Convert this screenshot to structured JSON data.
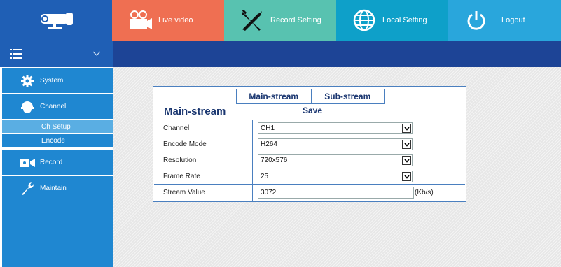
{
  "header": {
    "tabs": [
      {
        "label": "Live video",
        "icon": "camera-icon"
      },
      {
        "label": "Record Setting",
        "icon": "tools-icon"
      },
      {
        "label": "Local Setting",
        "icon": "globe-icon"
      },
      {
        "label": "Logout",
        "icon": "power-icon"
      }
    ]
  },
  "sidebar": {
    "items": [
      {
        "label": "System",
        "icon": "gear-icon"
      },
      {
        "label": "Channel",
        "icon": "dome-camera-icon"
      },
      {
        "label": "Record",
        "icon": "video-camera-icon"
      },
      {
        "label": "Maintain",
        "icon": "wrench-icon"
      }
    ],
    "channel_subitems": [
      "Ch Setup",
      "Encode"
    ]
  },
  "panel": {
    "stream_tabs": [
      "Main-stream",
      "Sub-stream"
    ],
    "section_title": "Main-stream",
    "save_label": "Save",
    "fields": [
      {
        "label": "Channel",
        "value": "CH1",
        "type": "select"
      },
      {
        "label": "Encode Mode",
        "value": "H264",
        "type": "select"
      },
      {
        "label": "Resolution",
        "value": "720x576",
        "type": "select"
      },
      {
        "label": "Frame Rate",
        "value": "25",
        "type": "select"
      },
      {
        "label": "Stream Value",
        "value": "3072",
        "type": "text",
        "unit": "(Kb/s)"
      }
    ]
  },
  "colors": {
    "live_tab": "#ef6f52",
    "record_tab": "#58c2b0",
    "local_tab": "#0ea0c9",
    "logout_tab": "#29a6dc",
    "sidebar": "#1f87d1",
    "header_dark": "#1d4496"
  }
}
